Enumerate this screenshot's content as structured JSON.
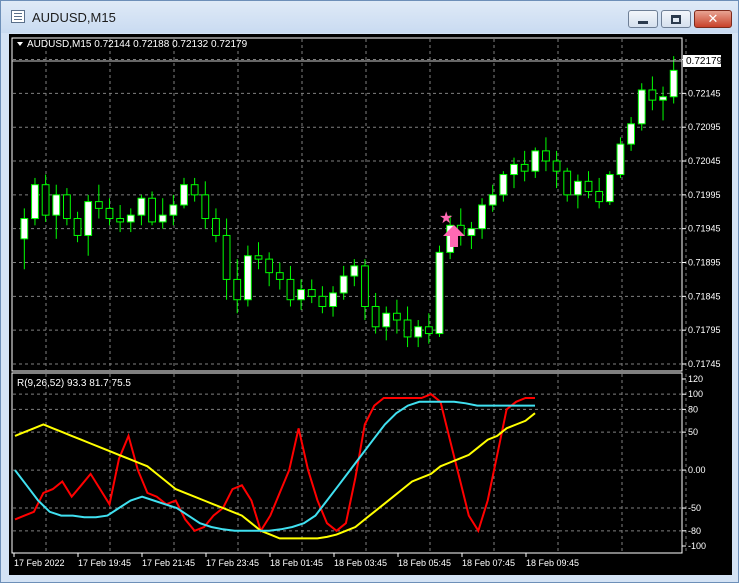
{
  "window": {
    "title": "AUDUSD,M15",
    "buttons": {
      "minimize": "minimize-icon",
      "maximize": "maximize-icon",
      "close": "close-icon"
    }
  },
  "chart": {
    "symbol_info": "AUDUSD,M15  0.72144 0.72188 0.72132 0.72179",
    "current_price": "0.72179",
    "price_ticks": [
      "0.72195",
      "0.72145",
      "0.72095",
      "0.72045",
      "0.71995",
      "0.71945",
      "0.71895",
      "0.71845",
      "0.71795",
      "0.71745"
    ],
    "indicator_label": "R(9,26,52) 93.3 81.7 75.5",
    "indicator_ticks": [
      "120",
      "100",
      "80",
      "50",
      "0.00",
      "-50",
      "-80",
      "-100"
    ],
    "time_ticks": [
      "17 Feb 2022",
      "17 Feb 19:45",
      "17 Feb 21:45",
      "17 Feb 23:45",
      "18 Feb 01:45",
      "18 Feb 03:45",
      "18 Feb 05:45",
      "18 Feb 07:45",
      "18 Feb 09:45"
    ],
    "colors": {
      "background": "#000000",
      "bull": "#ffffff",
      "wick": "#00ff00",
      "grid": "#808080",
      "line_red": "#ff0000",
      "line_yellow": "#ffff00",
      "line_cyan": "#40e0f0",
      "signal": "#ff69b4"
    },
    "icons": {
      "signal_star": "star-icon",
      "signal_arrow": "up-arrow-icon"
    }
  },
  "chart_data": {
    "type": "candlestick",
    "price_range": [
      0.71745,
      0.72215
    ],
    "candles_ohlc": [
      [
        0.7193,
        0.71975,
        0.71885,
        0.7196
      ],
      [
        0.7196,
        0.7202,
        0.7195,
        0.7201
      ],
      [
        0.7201,
        0.72025,
        0.71955,
        0.71965
      ],
      [
        0.71965,
        0.7201,
        0.7193,
        0.71995
      ],
      [
        0.71995,
        0.72005,
        0.7195,
        0.7196
      ],
      [
        0.7196,
        0.7197,
        0.71925,
        0.71935
      ],
      [
        0.71935,
        0.71995,
        0.71905,
        0.71985
      ],
      [
        0.71985,
        0.7201,
        0.7196,
        0.71975
      ],
      [
        0.71975,
        0.7199,
        0.7195,
        0.7196
      ],
      [
        0.7196,
        0.7198,
        0.7194,
        0.71955
      ],
      [
        0.71955,
        0.71975,
        0.7194,
        0.71965
      ],
      [
        0.71965,
        0.71995,
        0.7195,
        0.7199
      ],
      [
        0.7199,
        0.72,
        0.7195,
        0.71955
      ],
      [
        0.71955,
        0.7199,
        0.71945,
        0.71965
      ],
      [
        0.71965,
        0.71995,
        0.7195,
        0.7198
      ],
      [
        0.7198,
        0.7202,
        0.71975,
        0.7201
      ],
      [
        0.7201,
        0.7202,
        0.71985,
        0.71995
      ],
      [
        0.71995,
        0.72015,
        0.71945,
        0.7196
      ],
      [
        0.7196,
        0.71975,
        0.71925,
        0.71935
      ],
      [
        0.71935,
        0.7196,
        0.7184,
        0.7187
      ],
      [
        0.7187,
        0.719,
        0.7182,
        0.7184
      ],
      [
        0.7184,
        0.7192,
        0.7183,
        0.71905
      ],
      [
        0.71905,
        0.71925,
        0.71885,
        0.719
      ],
      [
        0.719,
        0.7191,
        0.7186,
        0.7188
      ],
      [
        0.7188,
        0.71895,
        0.71855,
        0.7187
      ],
      [
        0.7187,
        0.7189,
        0.7183,
        0.7184
      ],
      [
        0.7184,
        0.7187,
        0.71825,
        0.71855
      ],
      [
        0.71855,
        0.7187,
        0.71835,
        0.71845
      ],
      [
        0.71845,
        0.7186,
        0.7182,
        0.7183
      ],
      [
        0.7183,
        0.7186,
        0.71815,
        0.7185
      ],
      [
        0.7185,
        0.7189,
        0.7184,
        0.71875
      ],
      [
        0.71875,
        0.719,
        0.7186,
        0.7189
      ],
      [
        0.7189,
        0.719,
        0.7181,
        0.7183
      ],
      [
        0.7183,
        0.7185,
        0.7179,
        0.718
      ],
      [
        0.718,
        0.7183,
        0.7178,
        0.7182
      ],
      [
        0.7182,
        0.7184,
        0.7179,
        0.7181
      ],
      [
        0.7181,
        0.7183,
        0.7177,
        0.71785
      ],
      [
        0.71785,
        0.7181,
        0.7177,
        0.718
      ],
      [
        0.718,
        0.7182,
        0.71775,
        0.7179
      ],
      [
        0.7179,
        0.7192,
        0.71785,
        0.7191
      ],
      [
        0.7191,
        0.71965,
        0.719,
        0.7195
      ],
      [
        0.7195,
        0.71975,
        0.7192,
        0.71935
      ],
      [
        0.71935,
        0.71955,
        0.71915,
        0.71945
      ],
      [
        0.71945,
        0.7199,
        0.7193,
        0.7198
      ],
      [
        0.7198,
        0.7201,
        0.7197,
        0.71995
      ],
      [
        0.71995,
        0.7203,
        0.71985,
        0.72025
      ],
      [
        0.72025,
        0.7205,
        0.72005,
        0.7204
      ],
      [
        0.7204,
        0.7206,
        0.72015,
        0.7203
      ],
      [
        0.7203,
        0.72065,
        0.7202,
        0.7206
      ],
      [
        0.7206,
        0.7208,
        0.7203,
        0.72045
      ],
      [
        0.72045,
        0.7206,
        0.72005,
        0.7203
      ],
      [
        0.7203,
        0.72035,
        0.71985,
        0.71995
      ],
      [
        0.71995,
        0.72025,
        0.71975,
        0.72015
      ],
      [
        0.72015,
        0.7203,
        0.7199,
        0.72
      ],
      [
        0.72,
        0.7202,
        0.71975,
        0.71985
      ],
      [
        0.71985,
        0.7203,
        0.7198,
        0.72025
      ],
      [
        0.72025,
        0.7208,
        0.7202,
        0.7207
      ],
      [
        0.7207,
        0.7211,
        0.7206,
        0.721
      ],
      [
        0.721,
        0.7216,
        0.7209,
        0.7215
      ],
      [
        0.7215,
        0.7217,
        0.7212,
        0.72135
      ],
      [
        0.72135,
        0.72155,
        0.72105,
        0.7214
      ],
      [
        0.7214,
        0.722,
        0.7213,
        0.72179
      ]
    ],
    "indicator": {
      "range": [
        -100,
        120
      ],
      "series": [
        {
          "values": [
            -65,
            -60,
            -55,
            -30,
            -25,
            -15,
            -35,
            -20,
            -5,
            -25,
            -45,
            15,
            45,
            0,
            -30,
            -35,
            -45,
            -40,
            -65,
            -80,
            -75,
            -60,
            -50,
            -25,
            -20,
            -40,
            -80,
            -60,
            -30,
            0,
            55,
            0,
            -40,
            -70,
            -80,
            -70,
            -10,
            60,
            85,
            95,
            95,
            95,
            95,
            95,
            100,
            90,
            40,
            -10,
            -60,
            -80,
            -40,
            20,
            80,
            90,
            95,
            95
          ]
        },
        {
          "values": [
            45,
            50,
            55,
            60,
            55,
            50,
            45,
            40,
            35,
            30,
            25,
            20,
            15,
            10,
            5,
            -5,
            -15,
            -25,
            -30,
            -35,
            -40,
            -45,
            -50,
            -55,
            -60,
            -70,
            -80,
            -85,
            -90,
            -90,
            -90,
            -90,
            -90,
            -88,
            -85,
            -80,
            -75,
            -65,
            -55,
            -45,
            -35,
            -25,
            -15,
            -10,
            -5,
            5,
            10,
            15,
            20,
            30,
            40,
            45,
            55,
            60,
            65,
            75
          ]
        },
        {
          "values": [
            0,
            -20,
            -40,
            -55,
            -60,
            -60,
            -62,
            -62,
            -60,
            -50,
            -40,
            -35,
            -40,
            -45,
            -50,
            -60,
            -70,
            -75,
            -78,
            -80,
            -80,
            -80,
            -80,
            -78,
            -75,
            -70,
            -60,
            -40,
            -20,
            0,
            20,
            40,
            60,
            75,
            85,
            90,
            90,
            90,
            90,
            88,
            85,
            85,
            85,
            85,
            85,
            85
          ]
        }
      ]
    },
    "time_labels": [
      "17 Feb 2022",
      "17 Feb 19:45",
      "17 Feb 21:45",
      "17 Feb 23:45",
      "18 Feb 01:45",
      "18 Feb 03:45",
      "18 Feb 05:45",
      "18 Feb 07:45",
      "18 Feb 09:45"
    ]
  }
}
